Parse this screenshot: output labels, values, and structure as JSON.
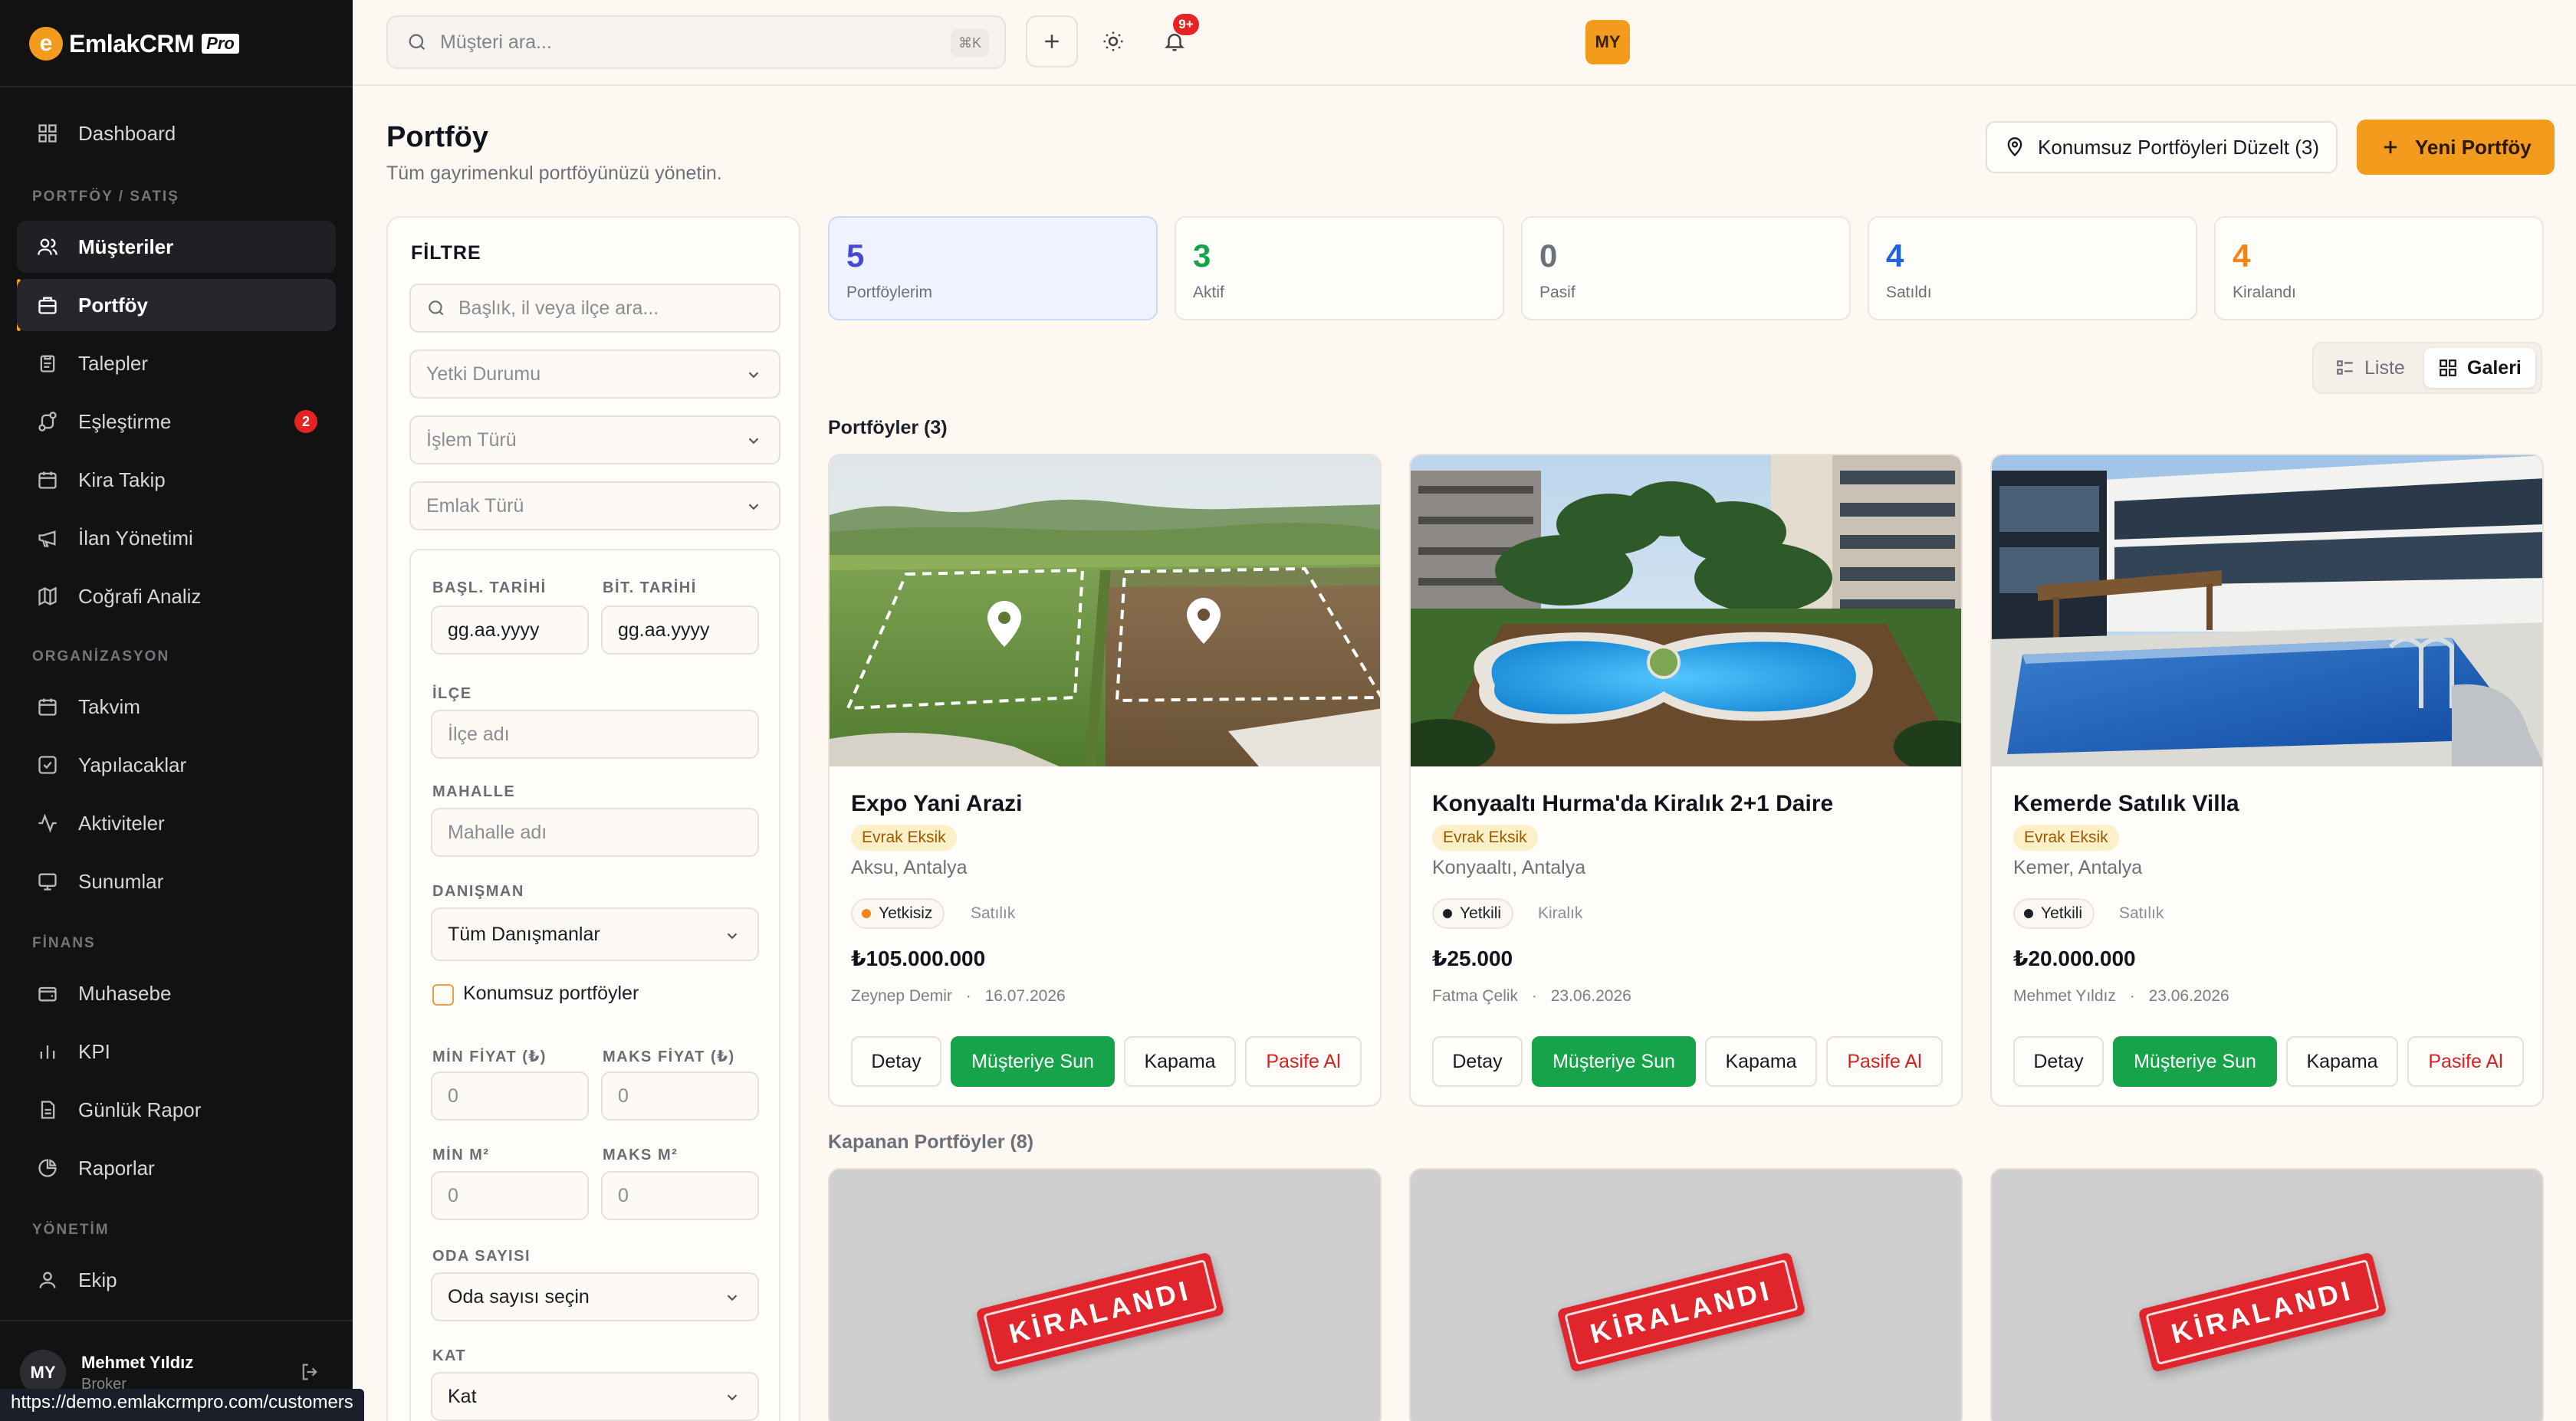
{
  "app": {
    "name": "EmlakCRM",
    "badge": "Pro"
  },
  "sidebar": {
    "items": [
      {
        "label": "Dashboard"
      },
      {
        "label": "Müşteriler"
      },
      {
        "label": "Portföy"
      },
      {
        "label": "Talepler"
      },
      {
        "label": "Eşleştirme",
        "badge": "2"
      },
      {
        "label": "Kira Takip"
      },
      {
        "label": "İlan Yönetimi"
      },
      {
        "label": "Coğrafi Analiz"
      },
      {
        "label": "Takvim"
      },
      {
        "label": "Yapılacaklar"
      },
      {
        "label": "Aktiviteler"
      },
      {
        "label": "Sunumlar"
      },
      {
        "label": "Muhasebe"
      },
      {
        "label": "KPI"
      },
      {
        "label": "Günlük Rapor"
      },
      {
        "label": "Raporlar"
      },
      {
        "label": "Ekip"
      }
    ],
    "sections": [
      "PORTFÖY / SATIŞ",
      "ORGANİZASYON",
      "FİNANS",
      "YÖNETİM"
    ],
    "user": {
      "initials": "MY",
      "name": "Mehmet Yıldız",
      "role": "Broker"
    }
  },
  "status_url": "https://demo.emlakcrmpro.com/customers",
  "topbar": {
    "search_placeholder": "Müşteri ara...",
    "shortcut": "⌘K",
    "notification_count": "9+",
    "avatar_initials": "MY"
  },
  "header": {
    "title": "Portföy",
    "subtitle": "Tüm gayrimenkul portföyünüzü yönetin.",
    "fix_button": "Konumsuz Portföyleri Düzelt (3)",
    "new_button": "Yeni Portföy"
  },
  "filter": {
    "title": "FİLTRE",
    "search_placeholder": "Başlık, il veya ilçe ara...",
    "authority_select": "Yetki Durumu",
    "transaction_select": "İşlem Türü",
    "property_select": "Emlak Türü",
    "start_date_label": "BAŞL. TARİHİ",
    "end_date_label": "BİT. TARİHİ",
    "date_placeholder": "gg.aa.yyyy",
    "district_label": "İLÇE",
    "district_placeholder": "İlçe adı",
    "neighborhood_label": "MAHALLE",
    "neighborhood_placeholder": "Mahalle adı",
    "consultant_label": "DANIŞMAN",
    "consultant_value": "Tüm Danışmanlar",
    "no_location_label": "Konumsuz portföyler",
    "min_price_label": "MİN FİYAT (₺)",
    "max_price_label": "MAKS FİYAT (₺)",
    "min_price_value": "0",
    "max_price_value": "0",
    "min_m2_label": "MİN M²",
    "max_m2_label": "MAKS M²",
    "min_m2_value": "0",
    "max_m2_value": "0",
    "rooms_label": "ODA SAYISI",
    "rooms_value": "Oda sayısı seçin",
    "floor_label": "KAT",
    "floor_value": "Kat"
  },
  "stats": [
    {
      "value": "5",
      "label": "Portföylerim",
      "color": "#4a47d6"
    },
    {
      "value": "3",
      "label": "Aktif",
      "color": "#17a34a"
    },
    {
      "value": "0",
      "label": "Pasif",
      "color": "#6c7079"
    },
    {
      "value": "4",
      "label": "Satıldı",
      "color": "#2462d8"
    },
    {
      "value": "4",
      "label": "Kiralandı",
      "color": "#f0861a"
    }
  ],
  "view_toggle": {
    "list": "Liste",
    "gallery": "Galeri"
  },
  "portfolios_heading": "Portföyler (3)",
  "closed_heading": "Kapanan Portföyler (8)",
  "portfolios": [
    {
      "title": "Expo Yani Arazi",
      "tag": "Evrak Eksik",
      "location": "Aksu, Antalya",
      "authority": "Yetkisiz",
      "authority_color": "#f0861a",
      "kind": "Satılık",
      "price": "₺105.000.000",
      "agent": "Zeynep Demir",
      "date": "16.07.2026"
    },
    {
      "title": "Konyaaltı Hurma'da Kiralık 2+1 Daire",
      "tag": "Evrak Eksik",
      "location": "Konyaaltı, Antalya",
      "authority": "Yetkili",
      "authority_color": "#1b1f27",
      "kind": "Kiralık",
      "price": "₺25.000",
      "agent": "Fatma Çelik",
      "date": "23.06.2026"
    },
    {
      "title": "Kemerde Satılık Villa",
      "tag": "Evrak Eksik",
      "location": "Kemer, Antalya",
      "authority": "Yetkili",
      "authority_color": "#1b1f27",
      "kind": "Satılık",
      "price": "₺20.000.000",
      "agent": "Mehmet Yıldız",
      "date": "23.06.2026"
    }
  ],
  "card_actions": {
    "detail": "Detay",
    "present": "Müşteriye Sun",
    "close": "Kapama",
    "deactivate": "Pasife Al"
  },
  "closed_stamps": [
    "KİRALANDI",
    "KİRALANDI",
    "KİRALANDI"
  ],
  "meta_separator": "·"
}
